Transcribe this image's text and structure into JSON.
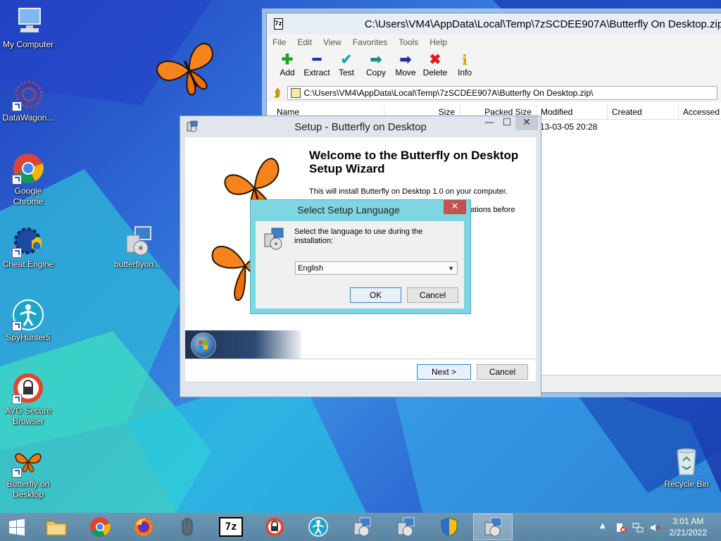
{
  "desktop": {
    "icons": [
      {
        "label": "My Computer"
      },
      {
        "label": "DataWagon..."
      },
      {
        "label": "Google Chrome"
      },
      {
        "label": "Cheat Engine"
      },
      {
        "label": "butterflyon..."
      },
      {
        "label": "SpyHunter5"
      },
      {
        "label": "AVG Secure Browser"
      },
      {
        "label": "Butterfly on Desktop"
      },
      {
        "label": "Recycle Bin"
      }
    ]
  },
  "zip_window": {
    "title": "C:\\Users\\VM4\\AppData\\Local\\Temp\\7zSCDEE907A\\Butterfly On Desktop.zip\\",
    "app_icon_text": "7z",
    "menu": [
      "File",
      "Edit",
      "View",
      "Favorites",
      "Tools",
      "Help"
    ],
    "toolbar": [
      {
        "label": "Add",
        "icon": "plus-icon",
        "glyph": "✚",
        "color": "#1aa81a"
      },
      {
        "label": "Extract",
        "icon": "minus-icon",
        "glyph": "━",
        "color": "#1f2fa8"
      },
      {
        "label": "Test",
        "icon": "check-icon",
        "glyph": "✔",
        "color": "#19a7b8"
      },
      {
        "label": "Copy",
        "icon": "copy-arrow-icon",
        "glyph": "➡",
        "color": "#1a8f7a"
      },
      {
        "label": "Move",
        "icon": "move-arrow-icon",
        "glyph": "➡",
        "color": "#1f2fa8"
      },
      {
        "label": "Delete",
        "icon": "delete-x-icon",
        "glyph": "✖",
        "color": "#e01b1b"
      },
      {
        "label": "Info",
        "icon": "info-icon",
        "glyph": "i",
        "color": "#c9a900"
      }
    ],
    "address": "C:\\Users\\VM4\\AppData\\Local\\Temp\\7zSCDEE907A\\Butterfly On Desktop.zip\\",
    "columns": [
      "Name",
      "Size",
      "Packed Size",
      "Modified",
      "Created",
      "Accessed"
    ],
    "row_modified": "13-03-05 20:28"
  },
  "setup_window": {
    "title": "Setup - Butterfly on Desktop",
    "welcome_heading": "Welcome to the Butterfly on Desktop Setup Wizard",
    "line1": "This will install Butterfly on Desktop 1.0 on your computer.",
    "line2_fragment": "tations before",
    "next_label": "Next >",
    "cancel_label": "Cancel",
    "minimize_glyph": "—",
    "maximize_glyph": "☐",
    "close_glyph": "✕"
  },
  "language_dialog": {
    "title": "Select Setup Language",
    "prompt": "Select the language to use during the installation:",
    "selected_language": "English",
    "ok_label": "OK",
    "cancel_label": "Cancel",
    "close_glyph": "✕"
  },
  "taskbar": {
    "time": "3:01 AM",
    "date": "2/21/2022",
    "zip_label": "7z",
    "show_hidden_glyph": "▲"
  }
}
